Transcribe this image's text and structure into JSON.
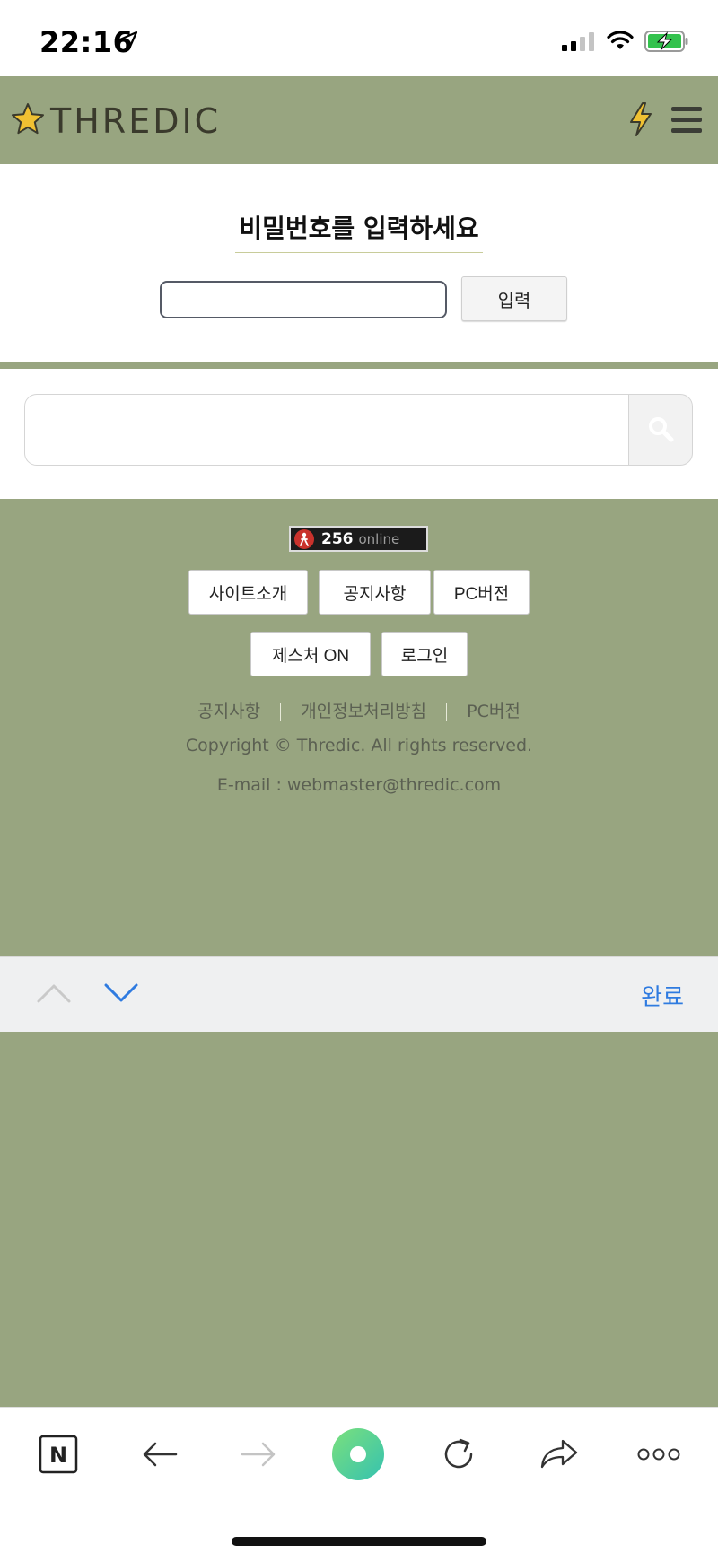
{
  "status_bar": {
    "time": "22:16",
    "location_icon": "location-arrow-icon",
    "signal_icon": "cellular-signal-icon",
    "wifi_icon": "wifi-icon",
    "battery_icon": "battery-charging-icon"
  },
  "header": {
    "logo_text": "THREDIC",
    "logo_icon": "star-icon",
    "bolt_icon": "lightning-icon",
    "menu_icon": "hamburger-menu-icon",
    "background": "#98a580"
  },
  "password_form": {
    "title": "비밀번호를 입력하세요",
    "input_value": "",
    "submit_label": "입력"
  },
  "search": {
    "input_value": "",
    "button_icon": "search-icon"
  },
  "footer": {
    "online_count": "256",
    "online_label": "online",
    "buttons": [
      "사이트소개",
      "공지사항",
      "PC버전",
      "제스처 ON",
      "로그인"
    ],
    "links": [
      "공지사항",
      "개인정보처리방침",
      "PC버전"
    ],
    "copyright": "Copyright © Thredic. All rights reserved.",
    "email": "E-mail : webmaster@thredic.com"
  },
  "keyboard_accessory": {
    "prev_icon": "chevron-up-icon",
    "next_icon": "chevron-down-icon",
    "done_label": "완료"
  },
  "browser_toolbar": {
    "items": [
      "naver-home-icon",
      "back-arrow-icon",
      "forward-arrow-icon",
      "green-dot-icon",
      "reload-icon",
      "share-icon",
      "more-icon"
    ],
    "naver_letter": "N"
  },
  "colors": {
    "accent_green": "#98a580",
    "link_blue": "#2f7be0",
    "badge_red": "#c9322c"
  }
}
